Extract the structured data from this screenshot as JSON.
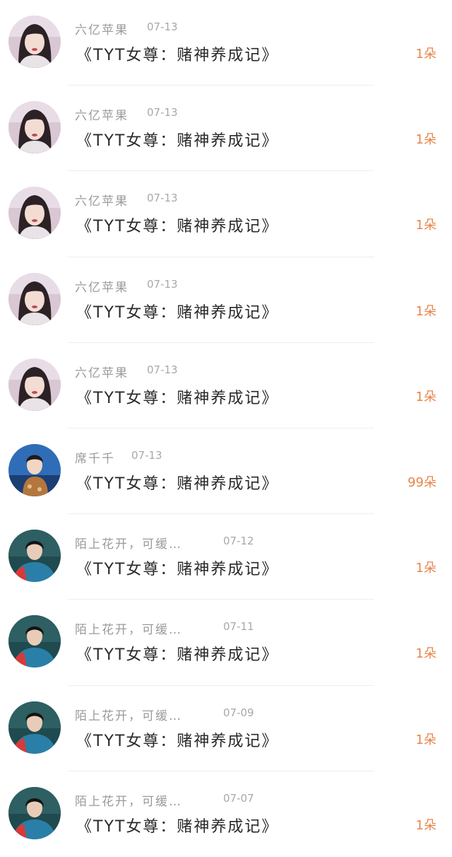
{
  "accent_color": "#e8844a",
  "items": [
    {
      "name": "六亿苹果",
      "date": "07-13",
      "title": "《TYT女尊：赌神养成记》",
      "count": "1朵",
      "avatar": "woman-avatar"
    },
    {
      "name": "六亿苹果",
      "date": "07-13",
      "title": "《TYT女尊：赌神养成记》",
      "count": "1朵",
      "avatar": "woman-avatar"
    },
    {
      "name": "六亿苹果",
      "date": "07-13",
      "title": "《TYT女尊：赌神养成记》",
      "count": "1朵",
      "avatar": "woman-avatar"
    },
    {
      "name": "六亿苹果",
      "date": "07-13",
      "title": "《TYT女尊：赌神养成记》",
      "count": "1朵",
      "avatar": "woman-avatar"
    },
    {
      "name": "六亿苹果",
      "date": "07-13",
      "title": "《TYT女尊：赌神养成记》",
      "count": "1朵",
      "avatar": "woman-avatar"
    },
    {
      "name": "席千千",
      "date": "07-13",
      "title": "《TYT女尊：赌神养成记》",
      "count": "99朵",
      "avatar": "young-man-avatar"
    },
    {
      "name": "陌上花开，可缓…",
      "date": "07-12",
      "title": "《TYT女尊：赌神养成记》",
      "count": "1朵",
      "avatar": "man-avatar"
    },
    {
      "name": "陌上花开，可缓…",
      "date": "07-11",
      "title": "《TYT女尊：赌神养成记》",
      "count": "1朵",
      "avatar": "man-avatar"
    },
    {
      "name": "陌上花开，可缓…",
      "date": "07-09",
      "title": "《TYT女尊：赌神养成记》",
      "count": "1朵",
      "avatar": "man-avatar"
    },
    {
      "name": "陌上花开，可缓…",
      "date": "07-07",
      "title": "《TYT女尊：赌神养成记》",
      "count": "1朵",
      "avatar": "man-avatar"
    }
  ]
}
